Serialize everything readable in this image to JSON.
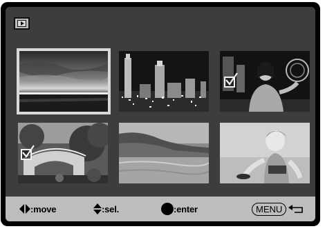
{
  "header": {
    "mode_icon": "playback-icon"
  },
  "thumbnails": [
    {
      "name": "thumb-sunset-sea",
      "selected": true,
      "checked": false
    },
    {
      "name": "thumb-city-night",
      "selected": false,
      "checked": false
    },
    {
      "name": "thumb-woman-night",
      "selected": false,
      "checked": true
    },
    {
      "name": "thumb-bridge-garden",
      "selected": false,
      "checked": true
    },
    {
      "name": "thumb-coastline",
      "selected": false,
      "checked": false
    },
    {
      "name": "thumb-child-beach",
      "selected": false,
      "checked": false
    }
  ],
  "bottom_bar": {
    "move_label": ":move",
    "sel_label": ":sel.",
    "enter_label": ":enter",
    "menu_label": "MENU",
    "icons": [
      "left-right-arrows-icon",
      "up-down-arrows-icon",
      "center-button-icon",
      "return-arrow-icon"
    ]
  }
}
